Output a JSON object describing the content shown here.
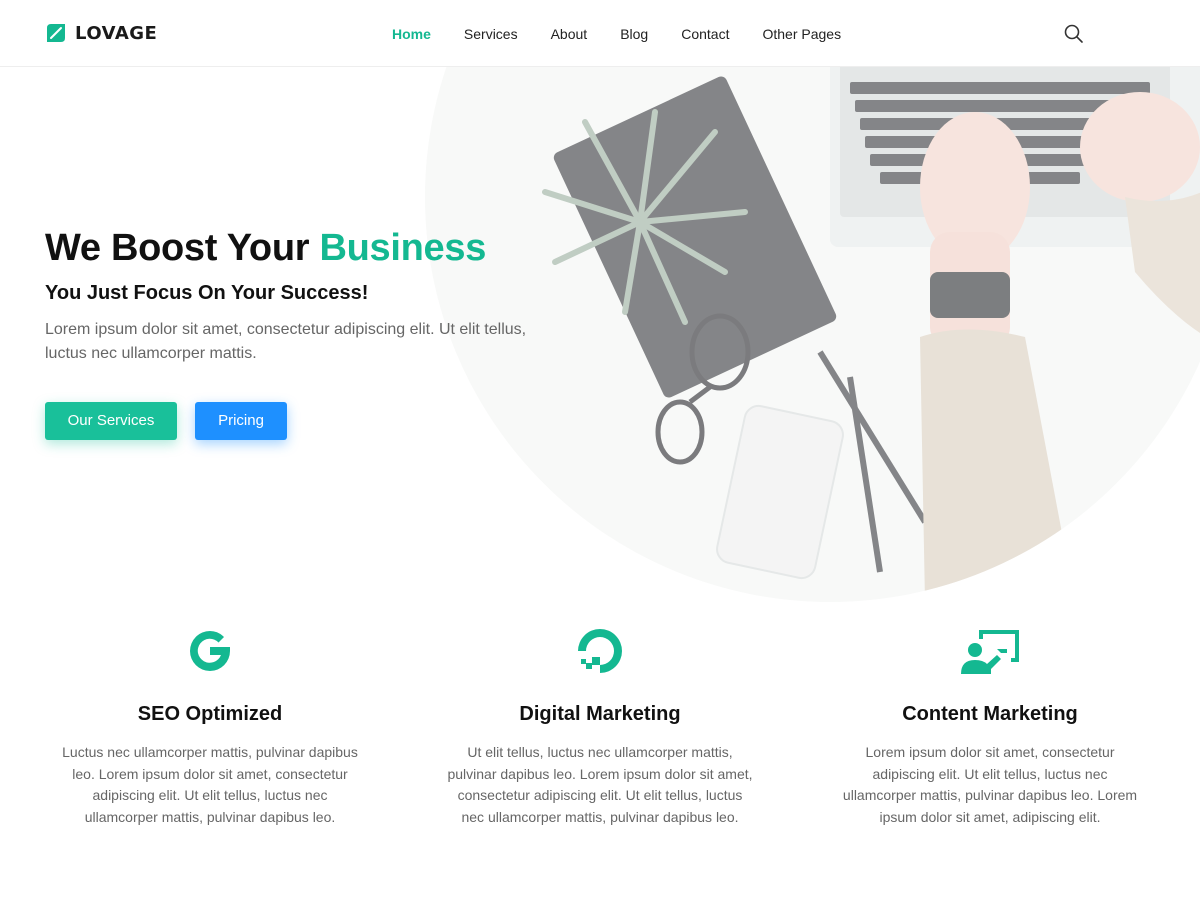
{
  "brand": {
    "name": "LOVAGE",
    "accent": "#14b891"
  },
  "nav": {
    "items": [
      {
        "label": "Home",
        "active": true
      },
      {
        "label": "Services",
        "active": false
      },
      {
        "label": "About",
        "active": false
      },
      {
        "label": "Blog",
        "active": false
      },
      {
        "label": "Contact",
        "active": false
      },
      {
        "label": "Other Pages",
        "active": false
      }
    ],
    "search_icon": "search-icon"
  },
  "hero": {
    "title_main": "We Boost Your",
    "title_accent": "Business",
    "subtitle": "You Just Focus On Your Success!",
    "text": "Lorem ipsum dolor sit amet, consectetur adipiscing elit. Ut elit tellus, luctus nec ullamcorper mattis.",
    "primary_button": "Our Services",
    "secondary_button": "Pricing",
    "primary_color": "#19c09a",
    "secondary_color": "#1e90ff"
  },
  "features": [
    {
      "icon": "google-g-icon",
      "title": "SEO Optimized",
      "text": "Luctus nec ullamcorper mattis, pulvinar dapibus leo. Lorem ipsum dolor sit amet, consectetur adipiscing elit. Ut elit tellus, luctus nec ullamcorper mattis, pulvinar dapibus leo."
    },
    {
      "icon": "digitalocean-icon",
      "title": "Digital Marketing",
      "text": "Ut elit tellus, luctus nec ullamcorper mattis, pulvinar dapibus leo. Lorem ipsum dolor sit amet, consectetur adipiscing elit. Ut elit tellus, luctus nec ullamcorper mattis, pulvinar dapibus leo."
    },
    {
      "icon": "presenter-icon",
      "title": "Content Marketing",
      "text": "Lorem ipsum dolor sit amet, consectetur adipiscing elit. Ut elit tellus, luctus nec ullamcorper mattis, pulvinar dapibus leo. Lorem ipsum dolor sit amet, adipiscing elit."
    }
  ]
}
